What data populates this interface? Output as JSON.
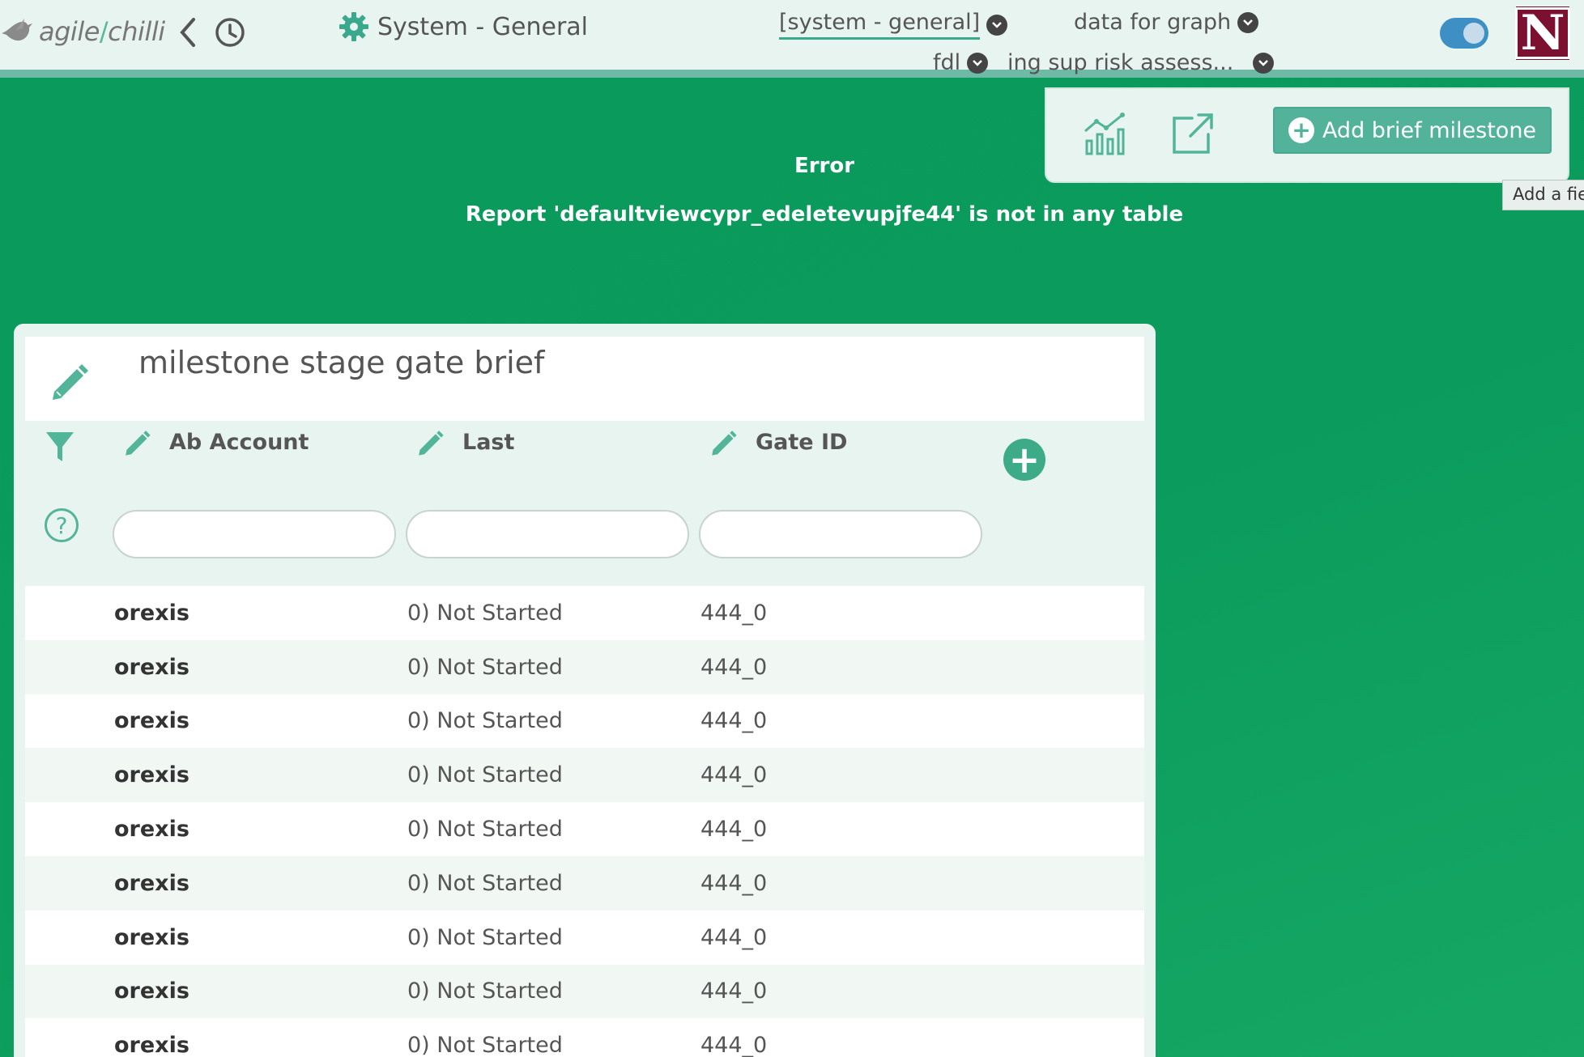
{
  "header": {
    "logo_left": "agile",
    "logo_slash": "/",
    "logo_right": "chilli",
    "page_title": "System - General",
    "selectors": [
      {
        "label": "[system - general]"
      },
      {
        "label": "data for graph"
      },
      {
        "label": "fdl"
      },
      {
        "label": "ing sup risk assess..."
      }
    ],
    "avatar_letter": "N"
  },
  "toolbar": {
    "add_button_label": "Add brief milestone",
    "tooltip": "Add a field"
  },
  "error": {
    "title": "Error",
    "message": "Report 'defaultviewcypr_edeletevupjfe44' is not in any table"
  },
  "panel": {
    "title": "milestone stage gate brief",
    "columns": [
      "Ab Account",
      "Last",
      "Gate ID"
    ],
    "rows": [
      [
        "orexis",
        "0) Not Started",
        "444_0"
      ],
      [
        "orexis",
        "0) Not Started",
        "444_0"
      ],
      [
        "orexis",
        "0) Not Started",
        "444_0"
      ],
      [
        "orexis",
        "0) Not Started",
        "444_0"
      ],
      [
        "orexis",
        "0) Not Started",
        "444_0"
      ],
      [
        "orexis",
        "0) Not Started",
        "444_0"
      ],
      [
        "orexis",
        "0) Not Started",
        "444_0"
      ],
      [
        "orexis",
        "0) Not Started",
        "444_0"
      ],
      [
        "orexis",
        "0) Not Started",
        "444_0"
      ]
    ]
  },
  "colors": {
    "background": "#0b9c5d",
    "accent": "#53b39a",
    "avatar": "#7b1030",
    "toggle": "#3e8fc4"
  }
}
